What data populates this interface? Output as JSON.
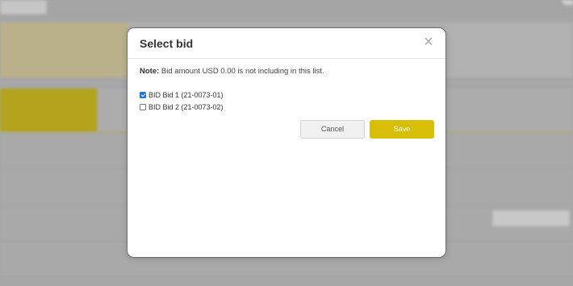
{
  "modal": {
    "title": "Select bid",
    "note_label": "Note:",
    "note_text": "Bid amount USD 0.00 is not including in this list.",
    "bids": [
      {
        "label": "BID Bid 1 (21-0073-01)",
        "checked": true
      },
      {
        "label": "BID Bid 2 (21-0073-02)",
        "checked": false
      }
    ],
    "cancel_label": "Cancel",
    "save_label": "Save",
    "close_symbol": "×"
  },
  "colors": {
    "accent": "#d7bf08",
    "overlay": "#a7a7a7",
    "checkbox_checked": "#1a73e8"
  },
  "icons": {
    "close": "close-icon",
    "checkbox": "checkbox-icon"
  }
}
